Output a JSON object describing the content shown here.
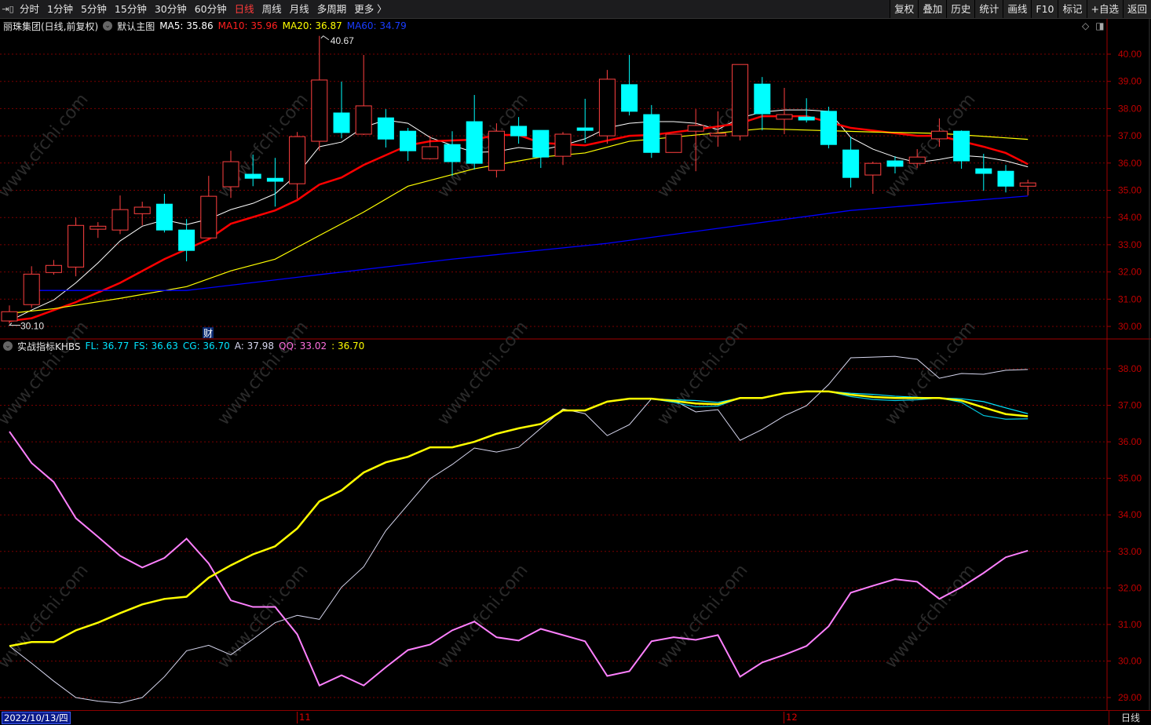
{
  "toolbar": {
    "tabs": [
      "分时",
      "1分钟",
      "5分钟",
      "15分钟",
      "30分钟",
      "60分钟",
      "日线",
      "周线",
      "月线",
      "多周期",
      "更多 〉"
    ],
    "active_tab": "日线",
    "buttons": [
      "复权",
      "叠加",
      "历史",
      "统计",
      "画线",
      "F10",
      "标记",
      "+自选",
      "返回"
    ]
  },
  "main_legend": {
    "title": "丽珠集团(日线,前复权)",
    "template": "默认主图",
    "ma5": "MA5: 35.86",
    "ma10": "MA10: 35.96",
    "ma20": "MA20: 36.87",
    "ma60": "MA60: 34.79"
  },
  "indicator_legend": {
    "name": "实战指标KHBS",
    "fl": "FL: 36.77",
    "fs": "FS: 36.63",
    "cg": "CG: 36.70",
    "a": "A: 37.98",
    "qq": "QQ: 33.02",
    "extra": ": 36.70"
  },
  "colors": {
    "up": "#ff4040",
    "down": "#00ffff",
    "ma5": "#ffffff",
    "ma10": "#ff0000",
    "ma20": "#ffff00",
    "ma60": "#0000ff",
    "qq": "#ff80ff",
    "a": "#d8d8f0",
    "cg": "#ffff00",
    "fl": "#00e5ff",
    "fs": "#00c8e0",
    "axis": "#c00000"
  },
  "annotations": {
    "max_label": "40.67",
    "min_label": "30.10",
    "fin_marker": "财",
    "watermark": "www.cfchi.com"
  },
  "x_axis": {
    "current_date": "2022/10/13/四",
    "months": [
      "11",
      "12"
    ],
    "period": "日线"
  },
  "chart_data": [
    {
      "type": "candlestick",
      "title": "丽珠集团(日线,前复权)",
      "ylim": [
        30,
        40
      ],
      "y_ticks": [
        "40.00",
        "39.00",
        "38.00",
        "37.00",
        "36.00",
        "35.00",
        "34.00",
        "33.00",
        "32.00",
        "31.00",
        "30.00"
      ],
      "grid": true,
      "ohlc": [
        [
          30.2,
          30.77,
          30.1,
          30.54
        ],
        [
          30.8,
          32.21,
          30.68,
          31.92
        ],
        [
          31.98,
          32.44,
          31.9,
          32.24
        ],
        [
          32.18,
          34.0,
          31.84,
          33.71
        ],
        [
          33.57,
          33.83,
          33.25,
          33.68
        ],
        [
          33.54,
          34.81,
          33.39,
          34.29
        ],
        [
          34.14,
          34.58,
          33.71,
          34.38
        ],
        [
          34.49,
          34.87,
          33.45,
          33.54
        ],
        [
          33.54,
          33.94,
          32.39,
          32.79
        ],
        [
          33.25,
          35.53,
          33.25,
          34.78
        ],
        [
          35.13,
          36.45,
          34.72,
          36.05
        ],
        [
          35.59,
          36.31,
          35.15,
          35.44
        ],
        [
          35.44,
          36.19,
          34.4,
          35.33
        ],
        [
          35.24,
          37.14,
          34.69,
          36.97
        ],
        [
          36.8,
          40.67,
          36.45,
          39.05
        ],
        [
          37.84,
          38.99,
          36.91,
          37.12
        ],
        [
          37.06,
          39.97,
          37.03,
          38.1
        ],
        [
          37.66,
          37.98,
          36.57,
          36.88
        ],
        [
          37.17,
          37.29,
          36.08,
          36.45
        ],
        [
          36.16,
          37.0,
          36.13,
          36.6
        ],
        [
          36.68,
          37.17,
          35.53,
          36.05
        ],
        [
          37.52,
          38.5,
          35.76,
          35.99
        ],
        [
          35.73,
          37.46,
          35.47,
          37.17
        ],
        [
          37.35,
          37.69,
          36.71,
          37.0
        ],
        [
          37.2,
          37.2,
          35.82,
          36.22
        ],
        [
          36.25,
          37.14,
          35.93,
          37.06
        ],
        [
          37.29,
          38.36,
          36.74,
          37.2
        ],
        [
          37.0,
          39.42,
          36.71,
          39.08
        ],
        [
          38.88,
          39.97,
          37.75,
          37.9
        ],
        [
          37.78,
          38.13,
          36.19,
          36.39
        ],
        [
          36.39,
          37.06,
          36.39,
          37.06
        ],
        [
          37.17,
          37.98,
          35.7,
          37.38
        ],
        [
          37.0,
          37.9,
          36.6,
          37.09
        ],
        [
          37.0,
          39.62,
          36.83,
          39.62
        ],
        [
          38.9,
          39.16,
          37.2,
          37.81
        ],
        [
          37.61,
          38.76,
          37.06,
          37.78
        ],
        [
          37.69,
          38.38,
          37.49,
          37.58
        ],
        [
          37.9,
          38.07,
          36.54,
          36.68
        ],
        [
          36.48,
          36.97,
          35.1,
          35.47
        ],
        [
          35.56,
          36.05,
          34.87,
          35.99
        ],
        [
          36.08,
          36.25,
          35.62,
          35.88
        ],
        [
          35.99,
          36.51,
          35.82,
          36.22
        ],
        [
          36.89,
          37.64,
          36.6,
          37.17
        ],
        [
          37.17,
          37.2,
          35.79,
          36.08
        ],
        [
          35.79,
          36.34,
          34.98,
          35.62
        ],
        [
          35.7,
          35.93,
          34.92,
          35.15
        ],
        [
          35.15,
          35.39,
          34.81,
          35.27
        ]
      ],
      "series": [
        {
          "name": "MA5",
          "points": [
            [
              1,
              30.2
            ],
            [
              2,
              30.6
            ],
            [
              3,
              30.97
            ],
            [
              4,
              31.6
            ],
            [
              5,
              32.33
            ],
            [
              6,
              33.14
            ],
            [
              7,
              33.68
            ],
            [
              8,
              33.91
            ],
            [
              9,
              33.74
            ],
            [
              10,
              33.94
            ],
            [
              11,
              34.29
            ],
            [
              12,
              34.52
            ],
            [
              13,
              34.87
            ],
            [
              14,
              35.59
            ],
            [
              15,
              36.6
            ],
            [
              16,
              36.77
            ],
            [
              17,
              37.32
            ],
            [
              18,
              37.58
            ],
            [
              19,
              37.46
            ],
            [
              20,
              36.94
            ],
            [
              21,
              36.65
            ],
            [
              22,
              36.39
            ],
            [
              23,
              36.42
            ],
            [
              24,
              36.57
            ],
            [
              25,
              36.48
            ],
            [
              26,
              36.65
            ],
            [
              27,
              36.89
            ],
            [
              28,
              37.29
            ],
            [
              29,
              37.46
            ],
            [
              30,
              37.52
            ],
            [
              31,
              37.52
            ],
            [
              32,
              37.46
            ],
            [
              33,
              37.23
            ],
            [
              34,
              37.66
            ],
            [
              35,
              37.87
            ],
            [
              36,
              37.95
            ],
            [
              37,
              37.95
            ],
            [
              38,
              37.9
            ],
            [
              39,
              36.94
            ],
            [
              40,
              36.51
            ],
            [
              41,
              36.22
            ],
            [
              42,
              36.02
            ],
            [
              43,
              36.13
            ],
            [
              44,
              36.28
            ],
            [
              45,
              36.22
            ],
            [
              46,
              36.08
            ],
            [
              47,
              35.86
            ]
          ]
        },
        {
          "name": "MA10",
          "points": [
            [
              1,
              30.2
            ],
            [
              2,
              30.3
            ],
            [
              4,
              30.89
            ],
            [
              6,
              31.6
            ],
            [
              8,
              32.47
            ],
            [
              10,
              33.2
            ],
            [
              11,
              33.77
            ],
            [
              13,
              34.26
            ],
            [
              14,
              34.64
            ],
            [
              15,
              35.21
            ],
            [
              16,
              35.47
            ],
            [
              17,
              35.93
            ],
            [
              19,
              36.65
            ],
            [
              20,
              36.8
            ],
            [
              22,
              36.86
            ],
            [
              23,
              37.03
            ],
            [
              24,
              37.03
            ],
            [
              25,
              36.74
            ],
            [
              27,
              36.65
            ],
            [
              29,
              37.0
            ],
            [
              30,
              37.03
            ],
            [
              32,
              37.23
            ],
            [
              34,
              37.46
            ],
            [
              35,
              37.72
            ],
            [
              37,
              37.72
            ],
            [
              39,
              37.29
            ],
            [
              42,
              37.0
            ],
            [
              43,
              37.0
            ],
            [
              45,
              36.6
            ],
            [
              46,
              36.37
            ],
            [
              47,
              35.96
            ]
          ]
        },
        {
          "name": "MA20",
          "points": [
            [
              1,
              30.48
            ],
            [
              3,
              30.65
            ],
            [
              6,
              31.03
            ],
            [
              9,
              31.46
            ],
            [
              11,
              32.04
            ],
            [
              13,
              32.47
            ],
            [
              15,
              33.34
            ],
            [
              17,
              34.2
            ],
            [
              19,
              35.15
            ],
            [
              22,
              35.79
            ],
            [
              25,
              36.22
            ],
            [
              27,
              36.37
            ],
            [
              29,
              36.8
            ],
            [
              32,
              37.03
            ],
            [
              35,
              37.26
            ],
            [
              40,
              37.14
            ],
            [
              43,
              37.09
            ],
            [
              47,
              36.87
            ]
          ]
        },
        {
          "name": "MA60",
          "points": [
            [
              2,
              31.32
            ],
            [
              9,
              31.32
            ],
            [
              15,
              31.9
            ],
            [
              21,
              32.47
            ],
            [
              28,
              33.05
            ],
            [
              34,
              33.71
            ],
            [
              39,
              34.26
            ],
            [
              47,
              34.79
            ]
          ]
        }
      ]
    },
    {
      "type": "line",
      "title": "实战指标KHBS",
      "ylim": [
        29,
        38
      ],
      "y_ticks": [
        "38.00",
        "37.00",
        "36.00",
        "35.00",
        "34.00",
        "33.00",
        "32.00",
        "31.00",
        "30.00",
        "29.00"
      ],
      "grid": true,
      "series": [
        {
          "name": "A",
          "values": [
            30.41,
            29.94,
            29.45,
            29.0,
            28.9,
            28.85,
            29.0,
            29.57,
            30.28,
            30.43,
            30.17,
            30.6,
            31.05,
            31.25,
            31.14,
            32.02,
            32.58,
            33.57,
            34.28,
            34.99,
            35.38,
            35.83,
            35.72,
            35.85,
            36.37,
            36.9,
            36.77,
            36.17,
            36.47,
            37.18,
            37.14,
            36.82,
            36.88,
            36.04,
            36.34,
            36.71,
            36.99,
            37.57,
            38.3,
            38.32,
            38.34,
            38.26,
            37.74,
            37.87,
            37.85,
            37.96,
            37.98
          ]
        },
        {
          "name": "QQ",
          "values": [
            36.28,
            35.42,
            34.9,
            33.91,
            33.4,
            32.88,
            32.56,
            32.82,
            33.35,
            32.67,
            31.66,
            31.48,
            31.48,
            30.73,
            29.33,
            29.61,
            29.33,
            29.83,
            30.3,
            30.45,
            30.84,
            31.08,
            30.65,
            30.56,
            30.88,
            30.71,
            30.54,
            29.59,
            29.72,
            30.54,
            30.65,
            30.58,
            30.71,
            29.57,
            29.96,
            30.17,
            30.41,
            30.95,
            31.87,
            32.06,
            32.24,
            32.17,
            31.7,
            32.02,
            32.41,
            32.84,
            33.02
          ]
        },
        {
          "name": "FL",
          "values": [
            30.41,
            30.52,
            30.52,
            30.84,
            31.05,
            31.31,
            31.55,
            31.7,
            31.76,
            32.28,
            32.62,
            32.92,
            33.14,
            33.63,
            34.37,
            34.67,
            35.16,
            35.44,
            35.59,
            35.85,
            35.85,
            36.0,
            36.22,
            36.37,
            36.49,
            36.86,
            36.86,
            37.1,
            37.18,
            37.18,
            37.15,
            37.13,
            37.08,
            37.2,
            37.2,
            37.33,
            37.38,
            37.38,
            37.33,
            37.3,
            37.25,
            37.22,
            37.2,
            37.18,
            37.1,
            36.93,
            36.77
          ]
        },
        {
          "name": "FS",
          "values": [
            30.41,
            30.52,
            30.52,
            30.84,
            31.05,
            31.31,
            31.55,
            31.7,
            31.76,
            32.28,
            32.62,
            32.92,
            33.14,
            33.63,
            34.37,
            34.67,
            35.16,
            35.44,
            35.59,
            35.85,
            35.85,
            36.0,
            36.22,
            36.37,
            36.49,
            36.86,
            36.86,
            37.1,
            37.18,
            37.18,
            37.08,
            36.96,
            36.98,
            37.2,
            37.2,
            37.33,
            37.38,
            37.38,
            37.24,
            37.16,
            37.13,
            37.15,
            37.2,
            37.08,
            36.72,
            36.62,
            36.63
          ]
        },
        {
          "name": "CG",
          "values": [
            30.41,
            30.52,
            30.52,
            30.84,
            31.05,
            31.31,
            31.55,
            31.7,
            31.76,
            32.28,
            32.62,
            32.92,
            33.14,
            33.63,
            34.37,
            34.67,
            35.16,
            35.44,
            35.59,
            35.85,
            35.85,
            36.0,
            36.22,
            36.37,
            36.49,
            36.86,
            36.86,
            37.1,
            37.18,
            37.18,
            37.12,
            37.05,
            37.03,
            37.2,
            37.2,
            37.33,
            37.38,
            37.38,
            37.29,
            37.23,
            37.2,
            37.2,
            37.2,
            37.13,
            36.94,
            36.76,
            36.7
          ]
        }
      ]
    }
  ]
}
